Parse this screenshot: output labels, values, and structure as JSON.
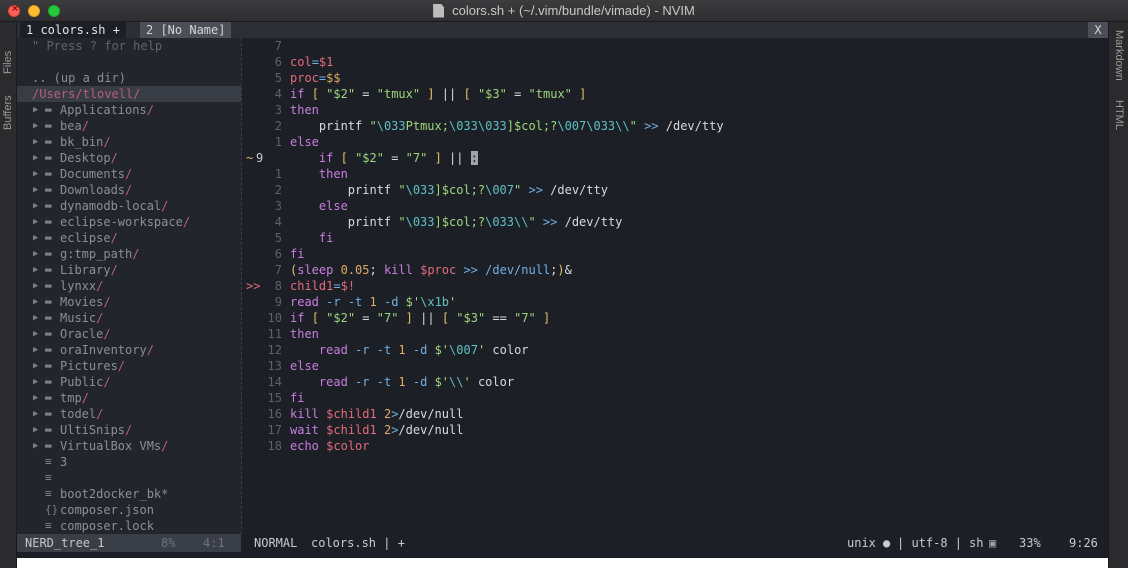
{
  "window": {
    "title": "colors.sh + (~/.vim/bundle/vimade) - NVIM",
    "close_glyph": "×"
  },
  "side_tabs": {
    "left": [
      "Files",
      "Buffers"
    ],
    "right": [
      "Markdown",
      "HTML"
    ]
  },
  "tabline": {
    "tabs": [
      {
        "label": "1 colors.sh +"
      },
      {
        "label": "2 [No Name]"
      }
    ],
    "close_label": "X"
  },
  "nerdtree": {
    "help": "\" Press ? for help",
    "up_dir": ".. (up a dir)",
    "root": "/Users/tlovell/",
    "dirs": [
      "Applications",
      "bea",
      "bk_bin",
      "Desktop",
      "Documents",
      "Downloads",
      "dynamodb-local",
      "eclipse-workspace",
      "eclipse",
      "g:tmp_path",
      "Library",
      "lynxx",
      "Movies",
      "Music",
      "Oracle",
      "oraInventory",
      "Pictures",
      "Public",
      "tmp",
      "todel",
      "UltiSnips",
      "VirtualBox VMs"
    ],
    "files": [
      {
        "icon": "≡",
        "name": "3"
      },
      {
        "icon": "≡",
        "name": ""
      },
      {
        "icon": "≡",
        "name": "boot2docker_bk*"
      },
      {
        "icon": "{}",
        "name": "composer.json"
      },
      {
        "icon": "≡",
        "name": "composer.lock"
      }
    ],
    "dir_slash": "/"
  },
  "code": {
    "lines": [
      {
        "num": "7",
        "sign": "",
        "tokens": [
          [
            "w",
            ""
          ]
        ]
      },
      {
        "num": "6",
        "sign": "",
        "tokens": [
          [
            "v",
            "col"
          ],
          [
            "o",
            "="
          ],
          [
            "v",
            "$1"
          ]
        ]
      },
      {
        "num": "5",
        "sign": "",
        "tokens": [
          [
            "v",
            "proc"
          ],
          [
            "o",
            "="
          ],
          [
            "n",
            "$$"
          ]
        ]
      },
      {
        "num": "4",
        "sign": "",
        "tokens": [
          [
            "k",
            "if"
          ],
          [
            "w",
            " "
          ],
          [
            "p",
            "["
          ],
          [
            "w",
            " "
          ],
          [
            "s",
            "\"$2\""
          ],
          [
            "w",
            " = "
          ],
          [
            "s",
            "\"tmux\""
          ],
          [
            "w",
            " "
          ],
          [
            "p",
            "]"
          ],
          [
            "w",
            " || "
          ],
          [
            "p",
            "["
          ],
          [
            "w",
            " "
          ],
          [
            "s",
            "\"$3\""
          ],
          [
            "w",
            " = "
          ],
          [
            "s",
            "\"tmux\""
          ],
          [
            "w",
            " "
          ],
          [
            "p",
            "]"
          ]
        ]
      },
      {
        "num": "3",
        "sign": "",
        "tokens": [
          [
            "k",
            "then"
          ]
        ]
      },
      {
        "num": "2",
        "sign": "",
        "tokens": [
          [
            "w",
            "    printf "
          ],
          [
            "s",
            "\""
          ],
          [
            "e",
            "\\033"
          ],
          [
            "s",
            "Ptmux;"
          ],
          [
            "e",
            "\\033\\033"
          ],
          [
            "s",
            "]$col;?"
          ],
          [
            "e",
            "\\007\\033\\\\"
          ],
          [
            "s",
            "\""
          ],
          [
            "w",
            " "
          ],
          [
            "o",
            ">>"
          ],
          [
            "w",
            " /dev/tty"
          ]
        ]
      },
      {
        "num": "1",
        "sign": "",
        "tokens": [
          [
            "k",
            "else"
          ]
        ]
      },
      {
        "num": "9",
        "sign": "~",
        "current": true,
        "tokens": [
          [
            "w",
            "    "
          ],
          [
            "k",
            "if"
          ],
          [
            "w",
            " "
          ],
          [
            "p",
            "["
          ],
          [
            "w",
            " "
          ],
          [
            "s",
            "\"$2\""
          ],
          [
            "w",
            " = "
          ],
          [
            "s",
            "\"7\""
          ],
          [
            "w",
            " "
          ],
          [
            "p",
            "]"
          ],
          [
            "w",
            " || "
          ],
          [
            "cursor",
            ":"
          ]
        ]
      },
      {
        "num": "1",
        "sign": "",
        "tokens": [
          [
            "w",
            "    "
          ],
          [
            "k",
            "then"
          ]
        ]
      },
      {
        "num": "2",
        "sign": "",
        "tokens": [
          [
            "w",
            "        printf "
          ],
          [
            "s",
            "\""
          ],
          [
            "e",
            "\\033"
          ],
          [
            "s",
            "]$col;?"
          ],
          [
            "e",
            "\\007"
          ],
          [
            "s",
            "\""
          ],
          [
            "w",
            " "
          ],
          [
            "o",
            ">>"
          ],
          [
            "w",
            " /dev/tty"
          ]
        ]
      },
      {
        "num": "3",
        "sign": "",
        "tokens": [
          [
            "w",
            "    "
          ],
          [
            "k",
            "else"
          ]
        ]
      },
      {
        "num": "4",
        "sign": "",
        "tokens": [
          [
            "w",
            "        printf "
          ],
          [
            "s",
            "\""
          ],
          [
            "e",
            "\\033"
          ],
          [
            "s",
            "]$col;?"
          ],
          [
            "e",
            "\\033\\\\"
          ],
          [
            "s",
            "\""
          ],
          [
            "w",
            " "
          ],
          [
            "o",
            ">>"
          ],
          [
            "w",
            " /dev/tty"
          ]
        ]
      },
      {
        "num": "5",
        "sign": "",
        "tokens": [
          [
            "w",
            "    "
          ],
          [
            "k",
            "fi"
          ]
        ]
      },
      {
        "num": "6",
        "sign": "",
        "tokens": [
          [
            "k",
            "fi"
          ]
        ]
      },
      {
        "num": "7",
        "sign": "",
        "tokens": [
          [
            "p",
            "("
          ],
          [
            "k",
            "sleep"
          ],
          [
            "w",
            " "
          ],
          [
            "n",
            "0.05"
          ],
          [
            "w",
            "; "
          ],
          [
            "k",
            "kill"
          ],
          [
            "w",
            " "
          ],
          [
            "v",
            "$proc"
          ],
          [
            "w",
            " "
          ],
          [
            "o",
            ">>"
          ],
          [
            "w",
            " "
          ],
          [
            "o",
            "/dev/null"
          ],
          [
            "w",
            ";"
          ],
          [
            "p",
            ")"
          ],
          [
            "w",
            "&"
          ]
        ]
      },
      {
        "num": "8",
        "sign": ">>",
        "signRed": true,
        "tokens": [
          [
            "v",
            "child1"
          ],
          [
            "o",
            "="
          ],
          [
            "v",
            "$!"
          ]
        ]
      },
      {
        "num": "9",
        "sign": "",
        "tokens": [
          [
            "k",
            "read"
          ],
          [
            "w",
            " "
          ],
          [
            "o",
            "-r"
          ],
          [
            "w",
            " "
          ],
          [
            "o",
            "-t"
          ],
          [
            "w",
            " "
          ],
          [
            "n",
            "1"
          ],
          [
            "w",
            " "
          ],
          [
            "o",
            "-d"
          ],
          [
            "w",
            " "
          ],
          [
            "s",
            "$'"
          ],
          [
            "e",
            "\\x1b"
          ],
          [
            "s",
            "'"
          ]
        ]
      },
      {
        "num": "10",
        "sign": "",
        "tokens": [
          [
            "k",
            "if"
          ],
          [
            "w",
            " "
          ],
          [
            "p",
            "["
          ],
          [
            "w",
            " "
          ],
          [
            "s",
            "\"$2\""
          ],
          [
            "w",
            " = "
          ],
          [
            "s",
            "\"7\""
          ],
          [
            "w",
            " "
          ],
          [
            "p",
            "]"
          ],
          [
            "w",
            " || "
          ],
          [
            "p",
            "["
          ],
          [
            "w",
            " "
          ],
          [
            "s",
            "\"$3\""
          ],
          [
            "w",
            " == "
          ],
          [
            "s",
            "\"7\""
          ],
          [
            "w",
            " "
          ],
          [
            "p",
            "]"
          ]
        ]
      },
      {
        "num": "11",
        "sign": "",
        "tokens": [
          [
            "k",
            "then"
          ]
        ]
      },
      {
        "num": "12",
        "sign": "",
        "tokens": [
          [
            "w",
            "    "
          ],
          [
            "k",
            "read"
          ],
          [
            "w",
            " "
          ],
          [
            "o",
            "-r"
          ],
          [
            "w",
            " "
          ],
          [
            "o",
            "-t"
          ],
          [
            "w",
            " "
          ],
          [
            "n",
            "1"
          ],
          [
            "w",
            " "
          ],
          [
            "o",
            "-d"
          ],
          [
            "w",
            " "
          ],
          [
            "s",
            "$'"
          ],
          [
            "e",
            "\\007"
          ],
          [
            "s",
            "'"
          ],
          [
            "w",
            " color"
          ]
        ]
      },
      {
        "num": "13",
        "sign": "",
        "tokens": [
          [
            "k",
            "else"
          ]
        ]
      },
      {
        "num": "14",
        "sign": "",
        "tokens": [
          [
            "w",
            "    "
          ],
          [
            "k",
            "read"
          ],
          [
            "w",
            " "
          ],
          [
            "o",
            "-r"
          ],
          [
            "w",
            " "
          ],
          [
            "o",
            "-t"
          ],
          [
            "w",
            " "
          ],
          [
            "n",
            "1"
          ],
          [
            "w",
            " "
          ],
          [
            "o",
            "-d"
          ],
          [
            "w",
            " "
          ],
          [
            "s",
            "$'"
          ],
          [
            "e",
            "\\\\"
          ],
          [
            "s",
            "'"
          ],
          [
            "w",
            " color"
          ]
        ]
      },
      {
        "num": "15",
        "sign": "",
        "tokens": [
          [
            "k",
            "fi"
          ]
        ]
      },
      {
        "num": "16",
        "sign": "",
        "tokens": [
          [
            "k",
            "kill"
          ],
          [
            "w",
            " "
          ],
          [
            "v",
            "$child1"
          ],
          [
            "w",
            " "
          ],
          [
            "n",
            "2"
          ],
          [
            "o",
            ">"
          ],
          [
            "w",
            "/dev/null"
          ]
        ]
      },
      {
        "num": "17",
        "sign": "",
        "tokens": [
          [
            "k",
            "wait"
          ],
          [
            "w",
            " "
          ],
          [
            "v",
            "$child1"
          ],
          [
            "w",
            " "
          ],
          [
            "n",
            "2"
          ],
          [
            "o",
            ">"
          ],
          [
            "w",
            "/dev/null"
          ]
        ]
      },
      {
        "num": "18",
        "sign": "",
        "tokens": [
          [
            "k",
            "echo"
          ],
          [
            "w",
            " "
          ],
          [
            "v",
            "$color"
          ]
        ]
      }
    ]
  },
  "statusline": {
    "tree_name": "NERD_tree_1",
    "tree_pct": "8%",
    "tree_pos": "4:1",
    "mode": "NORMAL",
    "file": "colors.sh | +",
    "format": "unix",
    "encoding": "| utf-8 |",
    "filetype": "sh",
    "percent": "33%",
    "position": "9:26"
  },
  "colors": {
    "editor_bg": "#1c1f26",
    "tree_bg": "#22252c",
    "keyword": "#c97ee0",
    "variable": "#e36b7c",
    "string": "#9ed77b",
    "operator": "#73b0e4"
  }
}
